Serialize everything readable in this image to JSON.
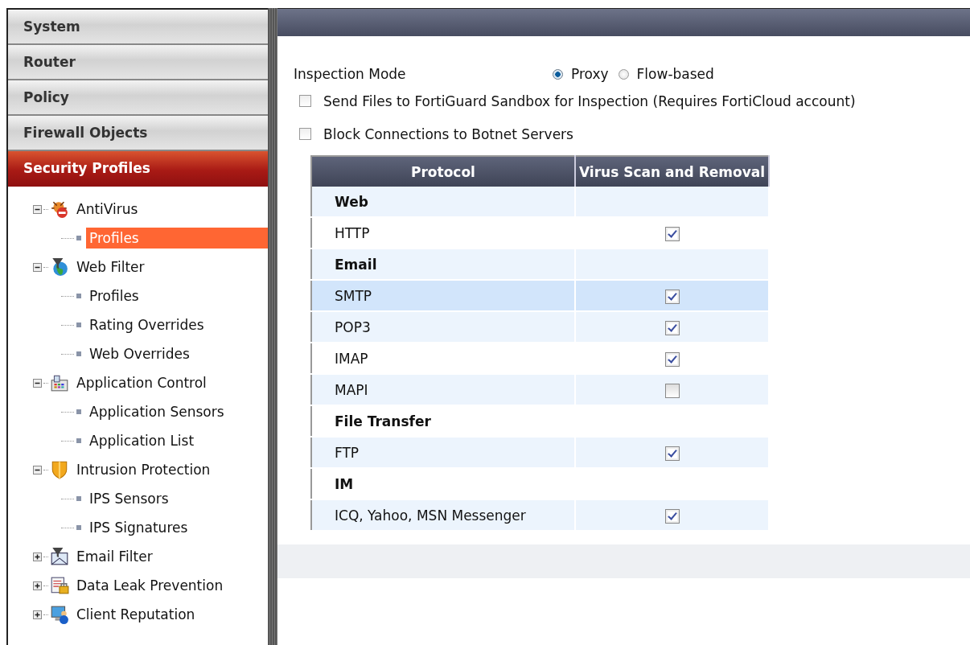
{
  "nav": [
    {
      "label": "System",
      "selected": false
    },
    {
      "label": "Router",
      "selected": false
    },
    {
      "label": "Policy",
      "selected": false
    },
    {
      "label": "Firewall Objects",
      "selected": false
    },
    {
      "label": "Security Profiles",
      "selected": true
    }
  ],
  "tree": [
    {
      "label": "AntiVirus",
      "expanded": true,
      "selected": false,
      "children": [
        {
          "label": "Profiles",
          "selected": true
        }
      ]
    },
    {
      "label": "Web Filter",
      "expanded": true,
      "selected": false,
      "children": [
        {
          "label": "Profiles",
          "selected": false
        },
        {
          "label": "Rating Overrides",
          "selected": false
        },
        {
          "label": "Web Overrides",
          "selected": false
        }
      ]
    },
    {
      "label": "Application Control",
      "expanded": true,
      "selected": false,
      "children": [
        {
          "label": "Application Sensors",
          "selected": false
        },
        {
          "label": "Application List",
          "selected": false
        }
      ]
    },
    {
      "label": "Intrusion Protection",
      "expanded": true,
      "selected": false,
      "children": [
        {
          "label": "IPS Sensors",
          "selected": false
        },
        {
          "label": "IPS Signatures",
          "selected": false
        }
      ]
    },
    {
      "label": "Email Filter",
      "expanded": false,
      "selected": false
    },
    {
      "label": "Data Leak Prevention",
      "expanded": false,
      "selected": false
    },
    {
      "label": "Client Reputation",
      "expanded": false,
      "selected": false
    }
  ],
  "inspection_mode": {
    "label": "Inspection Mode",
    "options": [
      {
        "label": "Proxy",
        "selected": true
      },
      {
        "label": "Flow-based",
        "selected": false
      }
    ]
  },
  "options": [
    {
      "label": "Send Files to FortiGuard Sandbox for Inspection (Requires FortiCloud account)",
      "checked": false
    },
    {
      "label": "Block Connections to Botnet Servers",
      "checked": false
    }
  ],
  "table": {
    "columns": [
      "Protocol",
      "Virus Scan and Removal"
    ],
    "rows": [
      {
        "kind": "group",
        "label": "Web",
        "selected": false
      },
      {
        "kind": "item",
        "label": "HTTP",
        "checked": true,
        "selected": false
      },
      {
        "kind": "group",
        "label": "Email",
        "selected": false
      },
      {
        "kind": "item",
        "label": "SMTP",
        "checked": true,
        "selected": true
      },
      {
        "kind": "item",
        "label": "POP3",
        "checked": true,
        "selected": false
      },
      {
        "kind": "item",
        "label": "IMAP",
        "checked": true,
        "selected": false
      },
      {
        "kind": "item",
        "label": "MAPI",
        "checked": false,
        "selected": false
      },
      {
        "kind": "group",
        "label": "File Transfer",
        "selected": false
      },
      {
        "kind": "item",
        "label": "FTP",
        "checked": true,
        "selected": false
      },
      {
        "kind": "group",
        "label": "IM",
        "selected": false
      },
      {
        "kind": "item",
        "label": "ICQ, Yahoo, MSN Messenger",
        "checked": true,
        "selected": false
      }
    ]
  }
}
